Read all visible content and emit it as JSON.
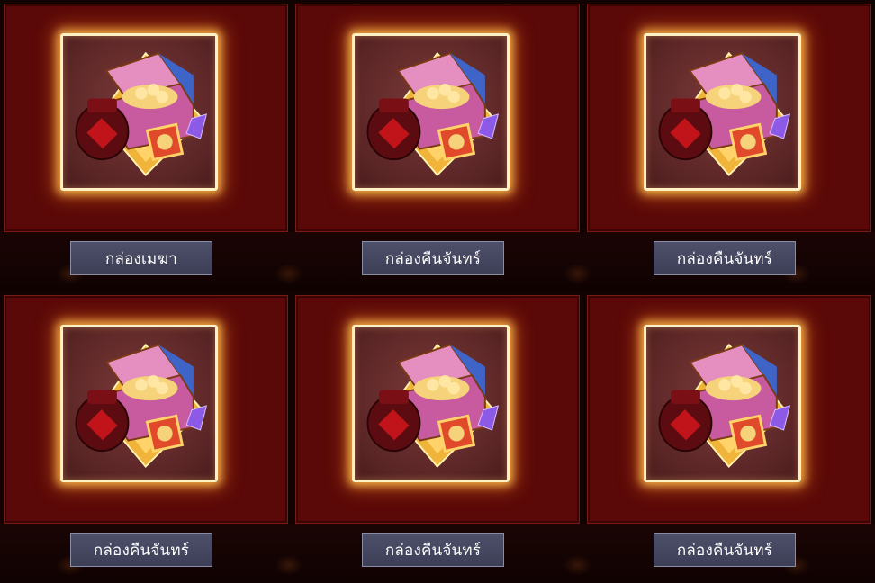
{
  "items": [
    {
      "label": "กล่องเมฆา",
      "icon": "treasure-chest-icon"
    },
    {
      "label": "กล่องคืนจันทร์",
      "icon": "treasure-chest-icon"
    },
    {
      "label": "กล่องคืนจันทร์",
      "icon": "treasure-chest-icon"
    },
    {
      "label": "กล่องคืนจันทร์",
      "icon": "treasure-chest-icon"
    },
    {
      "label": "กล่องคืนจันทร์",
      "icon": "treasure-chest-icon"
    },
    {
      "label": "กล่องคืนจันทร์",
      "icon": "treasure-chest-icon"
    }
  ],
  "colors": {
    "background": "#120303",
    "panel": "#5a0808",
    "frame_border": "#fff1c4",
    "frame_glow": "#ffbe50",
    "label_bg": "#46485f",
    "label_text": "#ffffff"
  }
}
